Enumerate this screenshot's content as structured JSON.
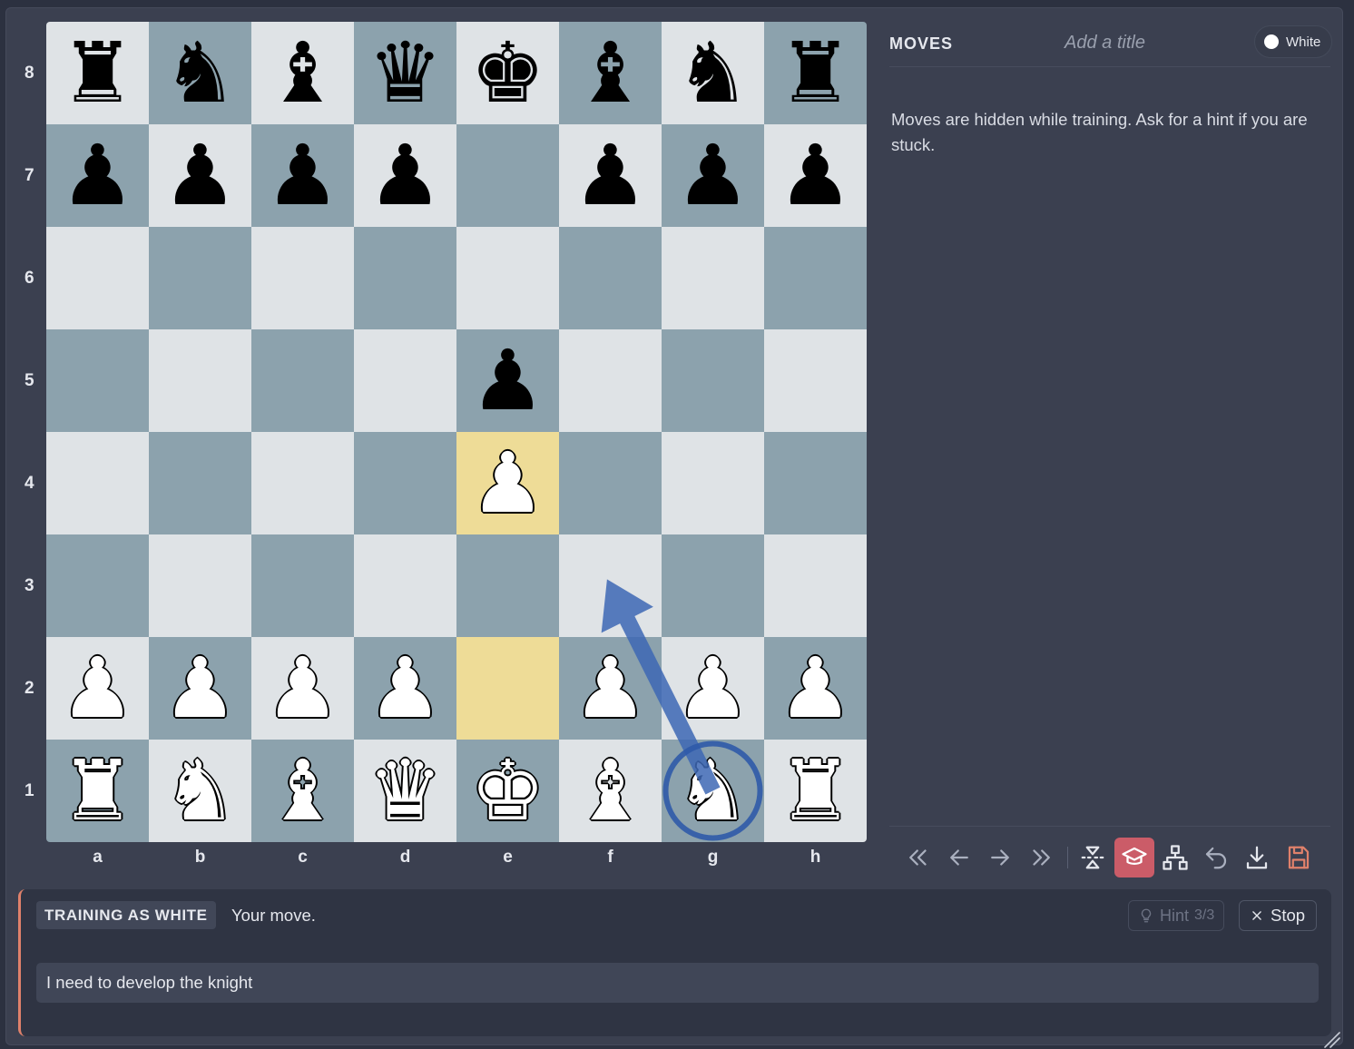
{
  "board": {
    "ranks": [
      "8",
      "7",
      "6",
      "5",
      "4",
      "3",
      "2",
      "1"
    ],
    "files": [
      "a",
      "b",
      "c",
      "d",
      "e",
      "f",
      "g",
      "h"
    ],
    "position": [
      [
        "bR",
        "bN",
        "bB",
        "bQ",
        "bK",
        "bB",
        "bN",
        "bR"
      ],
      [
        "bP",
        "bP",
        "bP",
        "bP",
        "",
        "bP",
        "bP",
        "bP"
      ],
      [
        "",
        "",
        "",
        "",
        "",
        "",
        "",
        ""
      ],
      [
        "",
        "",
        "",
        "",
        "bP",
        "",
        "",
        ""
      ],
      [
        "",
        "",
        "",
        "",
        "wP",
        "",
        "",
        ""
      ],
      [
        "",
        "",
        "",
        "",
        "",
        "",
        "",
        ""
      ],
      [
        "wP",
        "wP",
        "wP",
        "wP",
        "",
        "wP",
        "wP",
        "wP"
      ],
      [
        "wR",
        "wN",
        "wB",
        "wQ",
        "wK",
        "wB",
        "wN",
        "wR"
      ]
    ],
    "last_move_highlight": [
      "e2",
      "e4"
    ],
    "hint_arrow": {
      "from": "g1",
      "to": "f3",
      "color": "#3d67b4"
    },
    "hint_circle": {
      "square": "g1",
      "color": "#2f5aa8"
    },
    "colors": {
      "light": "#dfe3e6",
      "dark": "#8ca2ad",
      "highlight": "#eedc97"
    }
  },
  "moves_panel": {
    "title": "MOVES",
    "title_placeholder": "Add a title",
    "side_toggle_label": "White",
    "hidden_message": "Moves are hidden while training. Ask for a hint if you are stuck."
  },
  "toolbar": {
    "buttons": [
      {
        "name": "first-move",
        "icon": "double-chevron-left-icon"
      },
      {
        "name": "prev-move",
        "icon": "arrow-left-icon"
      },
      {
        "name": "next-move",
        "icon": "arrow-right-icon"
      },
      {
        "name": "last-move",
        "icon": "double-chevron-right-icon"
      },
      {
        "name": "flip-board",
        "icon": "flip-icon"
      },
      {
        "name": "training",
        "icon": "graduation-cap-icon",
        "active": true,
        "active_color": "#cb5c68"
      },
      {
        "name": "tree-view",
        "icon": "sitemap-icon"
      },
      {
        "name": "undo",
        "icon": "undo-icon"
      },
      {
        "name": "download",
        "icon": "download-icon"
      },
      {
        "name": "save",
        "icon": "save-icon",
        "color": "#e0816b"
      }
    ]
  },
  "training": {
    "badge": "TRAINING AS WHITE",
    "status": "Your move.",
    "hint_label": "Hint",
    "hint_count": "3/3",
    "stop_label": "Stop",
    "input_value": "I need to develop the knight",
    "accent": "#e0816b"
  }
}
